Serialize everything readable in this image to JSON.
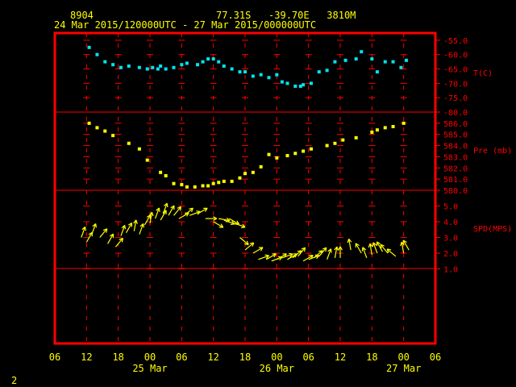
{
  "header": {
    "station": "8904",
    "location": "77.31S   -39.70E   3810M",
    "period": "24 Mar 2015/120000UTC - 27 Mar 2015/000000UTC"
  },
  "footer": {
    "page_number": "2"
  },
  "colors": {
    "frame": "#ff0000",
    "axis_text": "#ffff00",
    "right_labels": "#ff0000",
    "temperature": "#00e5ee",
    "pressure": "#ffff00",
    "wind": "#ffff00",
    "background": "#000000"
  },
  "chart_data": {
    "type": "scatter",
    "x_axis": {
      "units": "hours from 24 Mar 2015 06 UTC",
      "range": [
        0,
        72
      ],
      "ticks": [
        {
          "value": 0,
          "label": "06"
        },
        {
          "value": 6,
          "label": "12"
        },
        {
          "value": 12,
          "label": "18"
        },
        {
          "value": 18,
          "label": "00"
        },
        {
          "value": 24,
          "label": "06"
        },
        {
          "value": 30,
          "label": "12"
        },
        {
          "value": 36,
          "label": "18"
        },
        {
          "value": 42,
          "label": "00"
        },
        {
          "value": 48,
          "label": "06"
        },
        {
          "value": 54,
          "label": "12"
        },
        {
          "value": 60,
          "label": "18"
        },
        {
          "value": 66,
          "label": "00"
        },
        {
          "value": 72,
          "label": "06"
        }
      ],
      "date_labels": [
        {
          "value": 18,
          "label": "25 Mar"
        },
        {
          "value": 42,
          "label": "26 Mar"
        },
        {
          "value": 66,
          "label": "27 Mar"
        }
      ]
    },
    "panels": [
      {
        "name": "temperature",
        "ylabel": "T(C)",
        "range": [
          -80,
          -52.5
        ],
        "ticks": [
          -55,
          -60,
          -65,
          -70,
          -75,
          -80
        ],
        "tick_labels": [
          "-55.0",
          "-60.0",
          "-65.0",
          "-70.0",
          "-75.0",
          "-80.0"
        ],
        "series": {
          "x": [
            6.5,
            8,
            9.5,
            11,
            12.5,
            14,
            16,
            17.5,
            18.5,
            19.5,
            20,
            21,
            22.5,
            24,
            25,
            27,
            28,
            29,
            30,
            31,
            32,
            33.5,
            35,
            36,
            37.5,
            39,
            40.5,
            42,
            43,
            44,
            45.5,
            46.5,
            47,
            48.5,
            50,
            51.5,
            53,
            55,
            57,
            58,
            60,
            61,
            62.5,
            64,
            65.5,
            66.5
          ],
          "y": [
            -57.5,
            -60,
            -62.5,
            -63.5,
            -64.5,
            -64,
            -64.5,
            -65,
            -64.5,
            -65,
            -64,
            -65,
            -64.5,
            -63.5,
            -63,
            -63.5,
            -62.5,
            -61.5,
            -61.5,
            -62.5,
            -64,
            -65,
            -66,
            -66,
            -67.5,
            -67,
            -68,
            -67,
            -69.5,
            -70,
            -71,
            -71,
            -70.5,
            -70,
            -66,
            -65.5,
            -62.5,
            -62,
            -61.5,
            -59,
            -61.5,
            -66,
            -62.5,
            -62.5,
            -64.5,
            -62,
            -61.5
          ]
        }
      },
      {
        "name": "pressure",
        "ylabel": "Pre (mb)",
        "range": [
          580,
          587
        ],
        "ticks": [
          580,
          581,
          582,
          583,
          584,
          585,
          586
        ],
        "tick_labels": [
          "580.0",
          "581.0",
          "582.0",
          "583.0",
          "584.0",
          "585.0",
          "586.0"
        ],
        "series": {
          "x": [
            6.5,
            8,
            9.5,
            11,
            14,
            16,
            17.5,
            20,
            21,
            22.5,
            24,
            25,
            26.5,
            28,
            29,
            30,
            31,
            32,
            33.5,
            35,
            36,
            37.5,
            39,
            40.5,
            42,
            44,
            45.5,
            47,
            48.5,
            51.5,
            53,
            54.5,
            57,
            60,
            61,
            62.5,
            64,
            66
          ],
          "y": [
            586,
            585.6,
            585.3,
            584.9,
            584.2,
            583.7,
            582.7,
            581.6,
            581.3,
            580.6,
            580.5,
            580.3,
            580.3,
            580.4,
            580.4,
            580.6,
            580.7,
            580.8,
            580.8,
            581.1,
            581.5,
            581.6,
            582.1,
            583.2,
            582.9,
            583.1,
            583.3,
            583.5,
            583.7,
            584,
            584.2,
            584.5,
            584.7,
            585.2,
            585.4,
            585.6,
            585.7,
            586
          ]
        }
      },
      {
        "name": "wind_speed",
        "ylabel": "SPD(MPS)",
        "range": [
          0,
          6
        ],
        "ticks": [
          1,
          2,
          3,
          4,
          5
        ],
        "tick_labels": [
          "1.0",
          "2.0",
          "3.0",
          "4.0",
          "5.0"
        ],
        "series": {
          "x": [
            5,
            6,
            7,
            8.5,
            10,
            11.5,
            12.5,
            13.5,
            15,
            16,
            17,
            18,
            19,
            20,
            20.5,
            21.5,
            22.5,
            23.5,
            24.5,
            25.5,
            27,
            28.5,
            30,
            31,
            32,
            33,
            34,
            35,
            36,
            37.5,
            38.5,
            40,
            41,
            42,
            43,
            44,
            45,
            46,
            47,
            48,
            49,
            50,
            51.5,
            53,
            54,
            56,
            58,
            59,
            60,
            61,
            62,
            63,
            64.5,
            66,
            67
          ],
          "y": [
            3,
            2.7,
            3.2,
            3,
            2.6,
            2.4,
            3.1,
            3.3,
            3.4,
            3.2,
            3.8,
            3.9,
            4.2,
            4.1,
            4.5,
            4.4,
            4.4,
            4.2,
            4.4,
            4.4,
            4.5,
            4.2,
            4.0,
            4.2,
            4.1,
            4.2,
            3.9,
            3.0,
            2.2,
            2.0,
            1.6,
            1.6,
            1.5,
            1.6,
            1.7,
            1.6,
            1.7,
            1.8,
            1.5,
            1.6,
            1.7,
            1.8,
            1.6,
            1.7,
            1.7,
            2.2,
            2.0,
            1.7,
            1.9,
            2.0,
            2.1,
            2.0,
            1.8,
            2.0,
            2.2
          ],
          "direction_from_deg": [
            200,
            210,
            200,
            220,
            210,
            220,
            200,
            210,
            190,
            200,
            210,
            190,
            200,
            210,
            200,
            210,
            220,
            240,
            230,
            250,
            240,
            270,
            300,
            280,
            290,
            300,
            290,
            310,
            230,
            240,
            250,
            240,
            250,
            240,
            250,
            240,
            230,
            220,
            240,
            250,
            230,
            220,
            200,
            190,
            180,
            170,
            150,
            160,
            170,
            160,
            150,
            140,
            130,
            170,
            150
          ]
        }
      }
    ]
  }
}
